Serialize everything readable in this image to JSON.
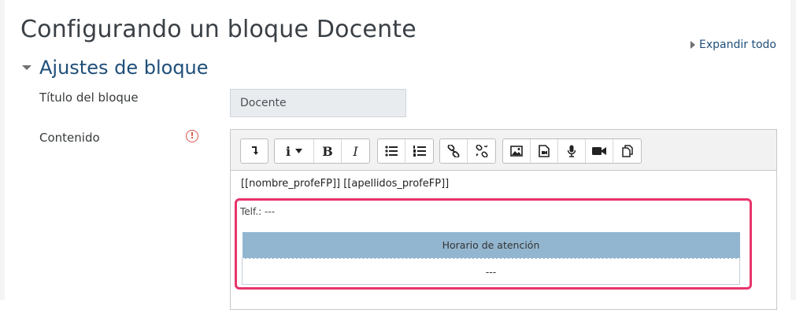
{
  "page": {
    "title": "Configurando un bloque Docente",
    "expand_all": "Expandir todo"
  },
  "section": {
    "title": "Ajustes de bloque"
  },
  "fields": {
    "block_title_label": "Título del bloque",
    "block_title_value": "Docente",
    "content_label": "Contenido",
    "required_icon": "!"
  },
  "toolbar": {
    "groups": [
      [
        "collapse-icon"
      ],
      [
        "style-icon",
        "bold-icon",
        "italic-icon"
      ],
      [
        "unordered-list-icon",
        "ordered-list-icon"
      ],
      [
        "link-icon",
        "unlink-icon"
      ],
      [
        "image-icon",
        "media-icon",
        "record-audio-icon",
        "record-video-icon",
        "manage-files-icon"
      ]
    ],
    "info_label": "i",
    "bold_label": "B",
    "italic_label": "I"
  },
  "editor_content": {
    "names": "[[nombre_profeFP]] [[apellidos_profeFP]]",
    "telf": "Telf.: ---",
    "table": {
      "header": "Horario de atención",
      "cell": "---"
    }
  },
  "colors": {
    "link": "#1f4e79",
    "highlight_border": "#e8336b",
    "table_header_bg": "#93b6d0",
    "required": "#d9534f"
  }
}
